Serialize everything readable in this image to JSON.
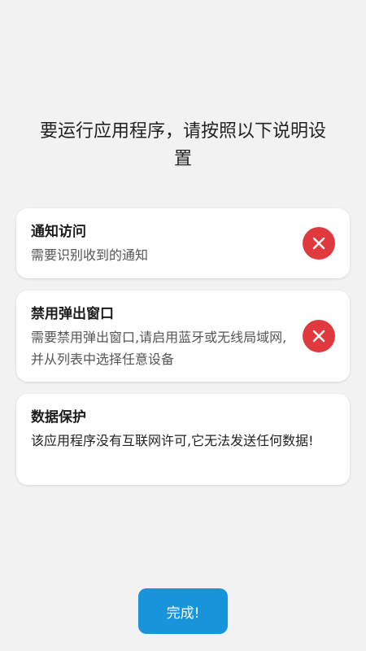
{
  "header": {
    "instruction": "要运行应用程序，请按照以下说明设置"
  },
  "permissions": [
    {
      "title": "通知访问",
      "description": "需要识别收到的通知",
      "status_icon": "close-icon",
      "status_color": "#e0393e"
    },
    {
      "title": "禁用弹出窗口",
      "description": "需要禁用弹出窗口,请启用蓝牙或无线局域网,并从列表中选择任意设备",
      "status_icon": "close-icon",
      "status_color": "#e0393e"
    },
    {
      "title": "数据保护",
      "description": "该应用程序没有互联网许可,它无法发送任何数据!"
    }
  ],
  "footer": {
    "done_label": "完成!",
    "button_color": "#1894dc"
  }
}
